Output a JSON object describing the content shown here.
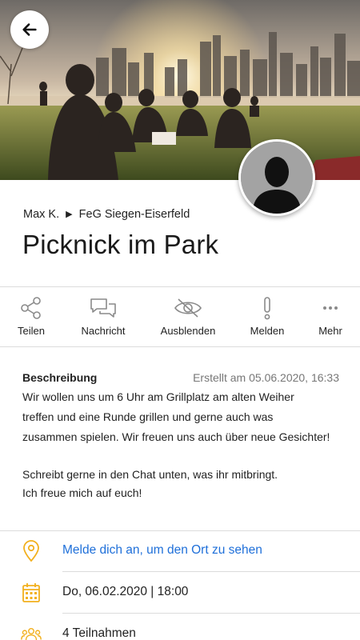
{
  "header": {
    "back_icon": "arrow-left-icon",
    "image_description_name": "hero-image"
  },
  "author": {
    "name": "Max K.",
    "group": "FeG Siegen-Eiserfeld",
    "separator": "▶"
  },
  "event": {
    "title": "Picknick im Park"
  },
  "actions": [
    {
      "label": "Teilen",
      "icon": "share-icon"
    },
    {
      "label": "Nachricht",
      "icon": "chat-bubbles-icon"
    },
    {
      "label": "Ausblenden",
      "icon": "eye-slash-icon"
    },
    {
      "label": "Melden",
      "icon": "exclamation-icon"
    },
    {
      "label": "Mehr",
      "icon": "more-dots-icon"
    }
  ],
  "description": {
    "label": "Beschreibung",
    "created": "Erstellt am 05.06.2020, 16:33",
    "lines": [
      "Wir wollen uns um 6 Uhr am Grillplatz am alten Weiher",
      "treffen und eine Runde grillen und gerne auch was",
      "zusammen spielen. Wir freuen uns auch über neue Gesichter!",
      "",
      "Schreibt gerne in den Chat unten, was ihr mitbringt.",
      "Ich freue mich auf euch!"
    ]
  },
  "info": {
    "location": {
      "text": "Melde dich an, um den Ort zu sehen",
      "icon": "location-pin-icon"
    },
    "date": {
      "text": "Do, 06.02.2020 | 18:00",
      "icon": "calendar-icon"
    },
    "participants": {
      "text": "4 Teilnahmen",
      "icon": "people-icon"
    }
  },
  "colors": {
    "accent_icon": "#f2b01e",
    "link": "#1e6fd9",
    "icon_gray": "#8a8a8a"
  }
}
